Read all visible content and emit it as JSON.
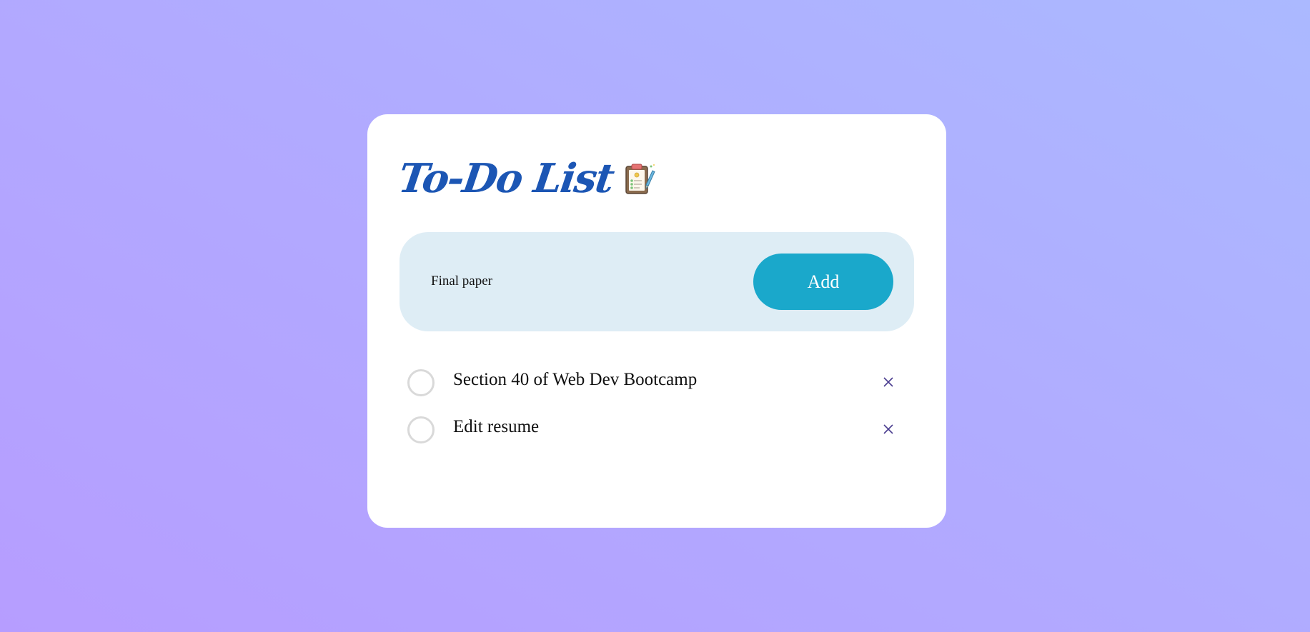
{
  "header": {
    "title": "To-Do List",
    "icon": "clipboard-checklist-icon"
  },
  "input": {
    "value": "Final paper",
    "placeholder": "",
    "add_label": "Add"
  },
  "tasks": [
    {
      "text": "Section 40 of Web Dev Bootcamp",
      "checked": false,
      "delete_icon": "close-icon"
    },
    {
      "text": "Edit resume",
      "checked": false,
      "delete_icon": "close-icon"
    }
  ],
  "colors": {
    "title": "#1c56b4",
    "add_button": "#1aa8cb",
    "input_bar": "#deedf5",
    "delete_icon": "#4a3d8f",
    "background_start": "#b69dff",
    "background_end": "#abb9ff"
  }
}
